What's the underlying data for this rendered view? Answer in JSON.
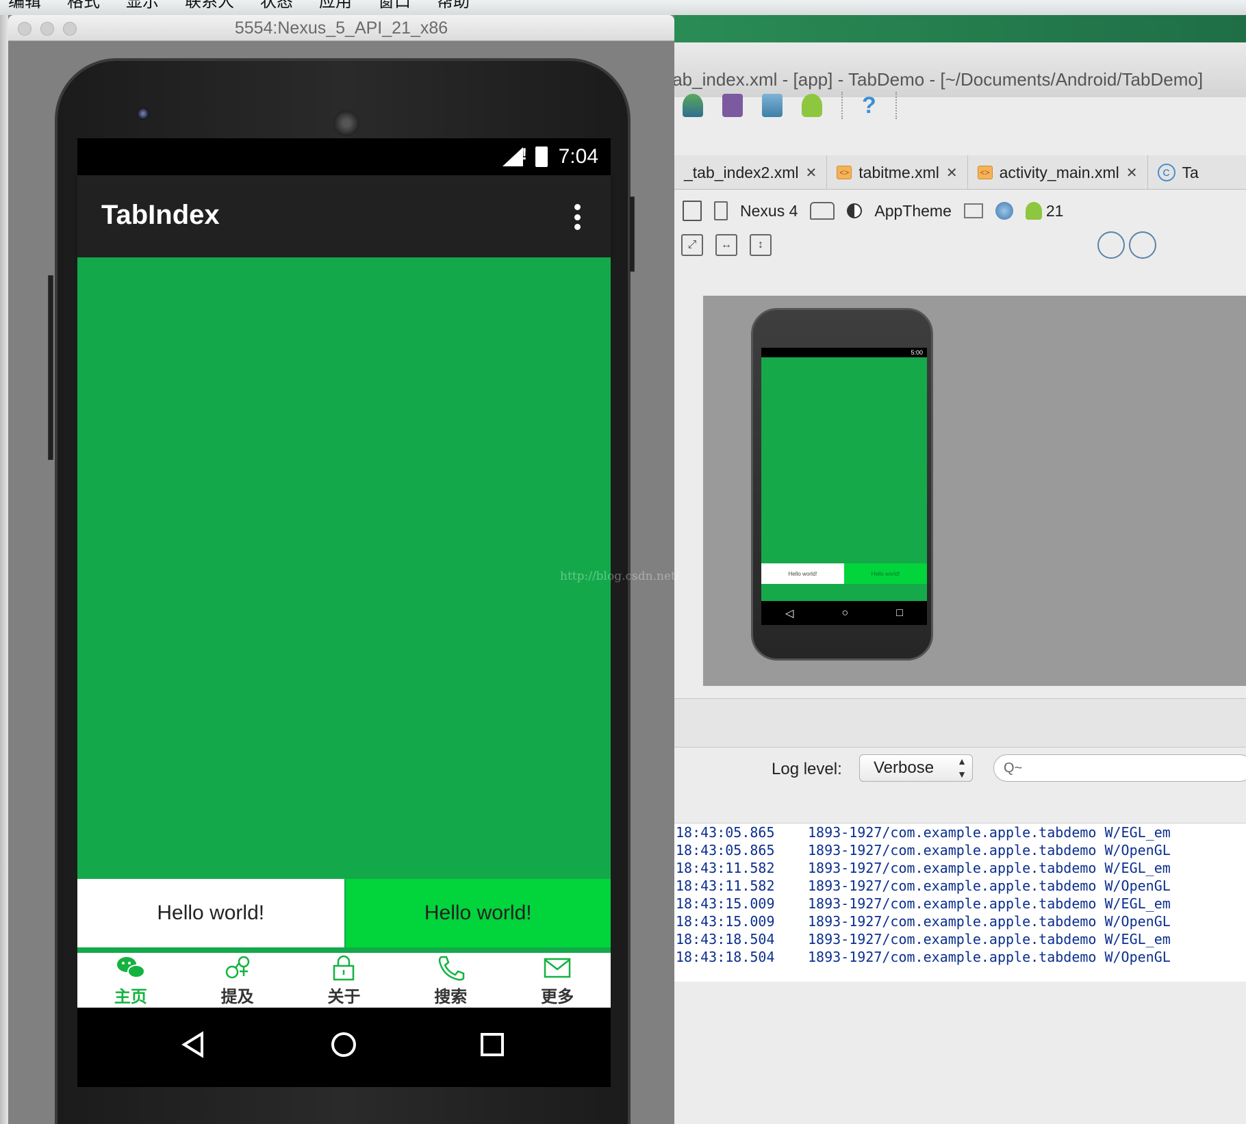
{
  "menubar": {
    "items": [
      "编辑",
      "格式",
      "显示",
      "联系人",
      "状态",
      "应用",
      "窗口",
      "帮助"
    ]
  },
  "emulator": {
    "window_title": "5554:Nexus_5_API_21_x86",
    "status_time": "7:04",
    "app_title": "TabIndex",
    "tabs": [
      "Hello world!",
      "Hello world!"
    ],
    "bottom_nav": [
      {
        "label": "主页",
        "icon": "wechat-icon",
        "active": true
      },
      {
        "label": "提及",
        "icon": "gender-icon",
        "active": false
      },
      {
        "label": "关于",
        "icon": "lock-icon",
        "active": false
      },
      {
        "label": "搜索",
        "icon": "phone-icon",
        "active": false
      },
      {
        "label": "更多",
        "icon": "mail-icon",
        "active": false
      }
    ],
    "colors": {
      "content_green": "#13a94a",
      "tab_green": "#02d43c",
      "active_nav": "#12b33f"
    }
  },
  "watermark": "http://blog.csdn.net/",
  "ide": {
    "title": "tab_index.xml - [app] - TabDemo - [~/Documents/Android/TabDemo]",
    "tabs": [
      {
        "label": "_tab_index2.xml"
      },
      {
        "label": "tabitme.xml"
      },
      {
        "label": "activity_main.xml"
      },
      {
        "label": "Ta"
      }
    ],
    "device": "Nexus 4",
    "theme": "AppTheme",
    "api_level": "21",
    "preview_time": "5:00",
    "preview_tabs": [
      "Hello world!",
      "Hello world!"
    ],
    "log_level_label": "Log level:",
    "log_level": "Verbose",
    "search_placeholder": "Q~",
    "logs": [
      {
        "time": "18:43:05.865",
        "text": "1893-1927/com.example.apple.tabdemo W/EGL_em"
      },
      {
        "time": "18:43:05.865",
        "text": "1893-1927/com.example.apple.tabdemo W/OpenGL"
      },
      {
        "time": "18:43:11.582",
        "text": "1893-1927/com.example.apple.tabdemo W/EGL_em"
      },
      {
        "time": "18:43:11.582",
        "text": "1893-1927/com.example.apple.tabdemo W/OpenGL"
      },
      {
        "time": "18:43:15.009",
        "text": "1893-1927/com.example.apple.tabdemo W/EGL_em"
      },
      {
        "time": "18:43:15.009",
        "text": "1893-1927/com.example.apple.tabdemo W/OpenGL"
      },
      {
        "time": "18:43:18.504",
        "text": "1893-1927/com.example.apple.tabdemo W/EGL_em"
      },
      {
        "time": "18:43:18.504",
        "text": "1893-1927/com.example.apple.tabdemo W/OpenGL"
      }
    ]
  }
}
